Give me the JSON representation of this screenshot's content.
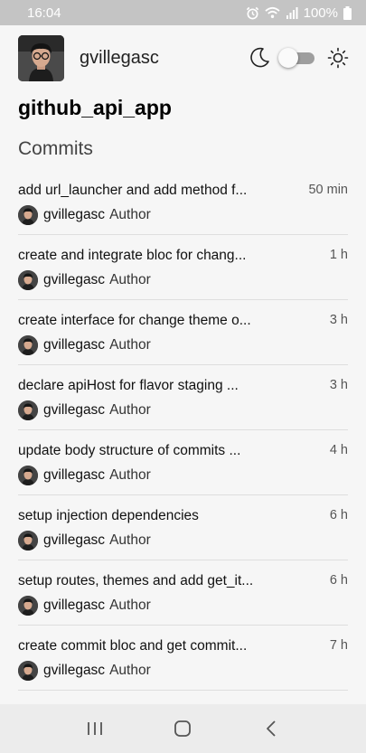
{
  "status_bar": {
    "time": "16:04",
    "battery": "100%",
    "icons": [
      "alarm-icon",
      "wifi-icon",
      "signal-icon",
      "battery-icon"
    ]
  },
  "header": {
    "username": "gvillegasc",
    "icons": [
      "avatar",
      "moon-icon",
      "theme-toggle",
      "sun-icon"
    ],
    "dark_mode": false
  },
  "app_title": "github_api_app",
  "section_title": "Commits",
  "commits": [
    {
      "message": "add url_launcher and add method f...",
      "time": "50 min",
      "author": "gvillegasc",
      "role": "Author"
    },
    {
      "message": "create and integrate bloc for chang...",
      "time": "1 h",
      "author": "gvillegasc",
      "role": "Author"
    },
    {
      "message": "create interface for change theme o...",
      "time": "3 h",
      "author": "gvillegasc",
      "role": "Author"
    },
    {
      "message": "declare apiHost for flavor staging ...",
      "time": "3 h",
      "author": "gvillegasc",
      "role": "Author"
    },
    {
      "message": "update body structure of commits ...",
      "time": "4 h",
      "author": "gvillegasc",
      "role": "Author"
    },
    {
      "message": "setup injection dependencies",
      "time": "6 h",
      "author": "gvillegasc",
      "role": "Author"
    },
    {
      "message": "setup routes, themes and add get_it...",
      "time": "6 h",
      "author": "gvillegasc",
      "role": "Author"
    },
    {
      "message": "create commit bloc and get commit...",
      "time": "7 h",
      "author": "gvillegasc",
      "role": "Author"
    }
  ],
  "nav_bar": {
    "buttons": [
      "recent-apps-icon",
      "home-icon",
      "back-icon"
    ]
  },
  "colors": {
    "status_bar": "#c4c4c4",
    "background": "#f6f6f6",
    "nav_bar": "#ececec",
    "toggle_track": "#9e9e9e"
  }
}
